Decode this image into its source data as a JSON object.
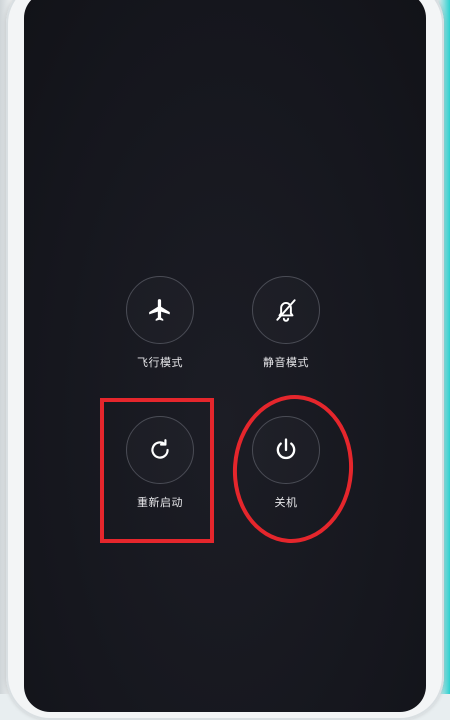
{
  "power_menu": {
    "airplane_mode": {
      "label": "飞行模式",
      "icon": "airplane-icon"
    },
    "silent_mode": {
      "label": "静音模式",
      "icon": "bell-off-icon"
    },
    "restart": {
      "label": "重新启动",
      "icon": "restart-icon"
    },
    "power_off": {
      "label": "关机",
      "icon": "power-icon"
    }
  },
  "annotations": {
    "color": "#e5262c"
  }
}
